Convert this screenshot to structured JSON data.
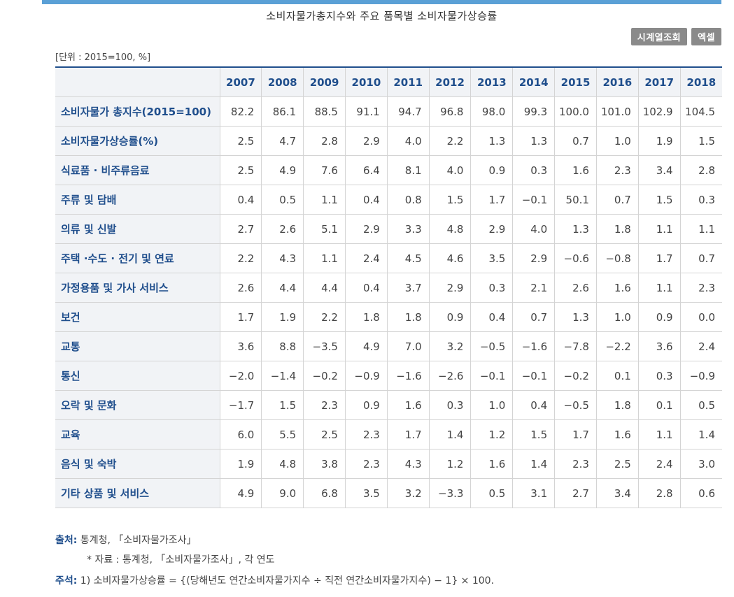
{
  "title": "소비자물가총지수와 주요 품목별 소비자물가상승률",
  "buttons": {
    "timeseries": "시계열조회",
    "excel": "엑셀"
  },
  "unit": "[단위 : 2015=100, %]",
  "table": {
    "years": [
      "2007",
      "2008",
      "2009",
      "2010",
      "2011",
      "2012",
      "2013",
      "2014",
      "2015",
      "2016",
      "2017",
      "2018"
    ],
    "rows": [
      {
        "label": "소비자물가 총지수(2015=100)",
        "values": [
          "82.2",
          "86.1",
          "88.5",
          "91.1",
          "94.7",
          "96.8",
          "98.0",
          "99.3",
          "100.0",
          "101.0",
          "102.9",
          "104.5"
        ]
      },
      {
        "label": "소비자물가상승률(%)",
        "values": [
          "2.5",
          "4.7",
          "2.8",
          "2.9",
          "4.0",
          "2.2",
          "1.3",
          "1.3",
          "0.7",
          "1.0",
          "1.9",
          "1.5"
        ]
      },
      {
        "label": "식료품 · 비주류음료",
        "values": [
          "2.5",
          "4.9",
          "7.6",
          "6.4",
          "8.1",
          "4.0",
          "0.9",
          "0.3",
          "1.6",
          "2.3",
          "3.4",
          "2.8"
        ]
      },
      {
        "label": "주류 및 담배",
        "values": [
          "0.4",
          "0.5",
          "1.1",
          "0.4",
          "0.8",
          "1.5",
          "1.7",
          "−0.1",
          "50.1",
          "0.7",
          "1.5",
          "0.3"
        ]
      },
      {
        "label": "의류 및 신발",
        "values": [
          "2.7",
          "2.6",
          "5.1",
          "2.9",
          "3.3",
          "4.8",
          "2.9",
          "4.0",
          "1.3",
          "1.8",
          "1.1",
          "1.1"
        ]
      },
      {
        "label": "주택 ·수도 · 전기 및 연료",
        "values": [
          "2.2",
          "4.3",
          "1.1",
          "2.4",
          "4.5",
          "4.6",
          "3.5",
          "2.9",
          "−0.6",
          "−0.8",
          "1.7",
          "0.7"
        ]
      },
      {
        "label": "가정용품 및 가사 서비스",
        "values": [
          "2.6",
          "4.4",
          "4.4",
          "0.4",
          "3.7",
          "2.9",
          "0.3",
          "2.1",
          "2.6",
          "1.6",
          "1.1",
          "2.3"
        ]
      },
      {
        "label": "보건",
        "values": [
          "1.7",
          "1.9",
          "2.2",
          "1.8",
          "1.8",
          "0.9",
          "0.4",
          "0.7",
          "1.3",
          "1.0",
          "0.9",
          "0.0"
        ]
      },
      {
        "label": "교통",
        "values": [
          "3.6",
          "8.8",
          "−3.5",
          "4.9",
          "7.0",
          "3.2",
          "−0.5",
          "−1.6",
          "−7.8",
          "−2.2",
          "3.6",
          "2.4"
        ]
      },
      {
        "label": "통신",
        "values": [
          "−2.0",
          "−1.4",
          "−0.2",
          "−0.9",
          "−1.6",
          "−2.6",
          "−0.1",
          "−0.1",
          "−0.2",
          "0.1",
          "0.3",
          "−0.9"
        ]
      },
      {
        "label": "오락 및 문화",
        "values": [
          "−1.7",
          "1.5",
          "2.3",
          "0.9",
          "1.6",
          "0.3",
          "1.0",
          "0.4",
          "−0.5",
          "1.8",
          "0.1",
          "0.5"
        ]
      },
      {
        "label": "교육",
        "values": [
          "6.0",
          "5.5",
          "2.5",
          "2.3",
          "1.7",
          "1.4",
          "1.2",
          "1.5",
          "1.7",
          "1.6",
          "1.1",
          "1.4"
        ]
      },
      {
        "label": "음식 및 숙박",
        "values": [
          "1.9",
          "4.8",
          "3.8",
          "2.3",
          "4.3",
          "1.2",
          "1.6",
          "1.4",
          "2.3",
          "2.5",
          "2.4",
          "3.0"
        ]
      },
      {
        "label": "기타 상품 및 서비스",
        "values": [
          "4.9",
          "9.0",
          "6.8",
          "3.5",
          "3.2",
          "−3.3",
          "0.5",
          "3.1",
          "2.7",
          "3.4",
          "2.8",
          "0.6"
        ]
      }
    ]
  },
  "footer": {
    "source_label": "출처:",
    "source_text": " 통계청, 「소비자물가조사」",
    "data_note": "* 자료 : 통계청, 「소비자물가조사」, 각 연도",
    "note_label": "주석:",
    "note_text": " 1) 소비자물가상승률 = {(당해년도 연간소비자물가지수 ÷ 직전 연간소비자물가지수) − 1} × 100."
  }
}
